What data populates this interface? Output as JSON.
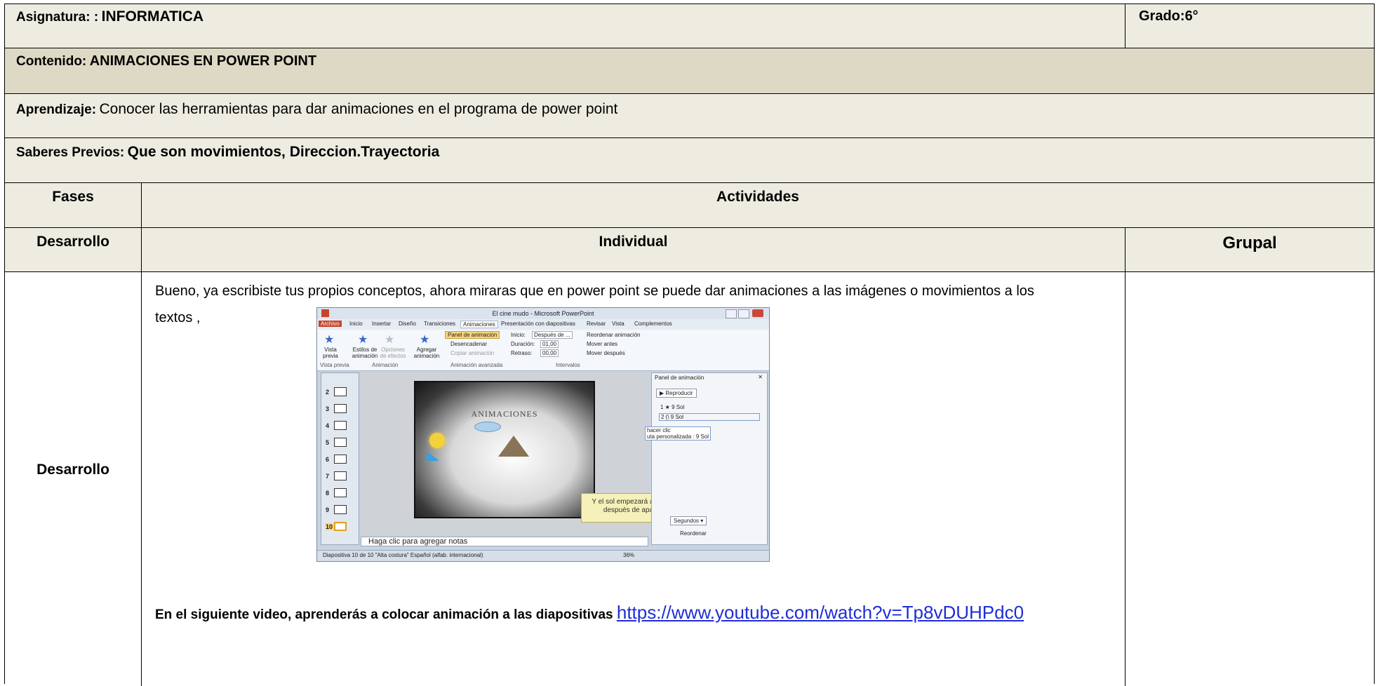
{
  "header": {
    "subject_label": "Asignatura: :",
    "subject_value": "INFORMATICA",
    "grade_label": "Grado:",
    "grade_value": "6°"
  },
  "content": {
    "label": "Contenido:",
    "value": "ANIMACIONES EN POWER POINT"
  },
  "learning": {
    "label": "Aprendizaje:",
    "value": "Conocer las herramientas para dar animaciones en el  programa de power point"
  },
  "prior": {
    "label": "Saberes Previos:",
    "value": "Que son movimientos, Direccion.Trayectoria"
  },
  "table": {
    "phases_header": "Fases",
    "activities_header": "Actividades",
    "dev_header": "Desarrollo",
    "individual_header": "Individual",
    "group_header": "Grupal",
    "row_phase": "Desarrollo",
    "intro_line1": "Bueno, ya escribiste tus propios conceptos, ahora miraras que en power point se puede dar animaciones a las imágenes o movimientos a los",
    "intro_line2": "textos  ,",
    "video_text": "En el siguiente video, aprenderás a colocar animación a las diapositivas",
    "video_link": "https://www.youtube.com/watch?v=Tp8vDUHPdc0"
  },
  "screenshot": {
    "window_title": "El cine mudo - Microsoft PowerPoint",
    "tabs": [
      "Archivo",
      "Inicio",
      "Insertar",
      "Diseño",
      "Transiciones",
      "Animaciones",
      "Presentación con diapositivas",
      "Revisar",
      "Vista",
      "Complementos"
    ],
    "ribbon_items": [
      "Vista previa",
      "Estilos de animación",
      "Opciones de efectos",
      "Agregar animación",
      "Panel de animación",
      "Desencadenar",
      "Copiar animación",
      "Inicio:",
      "Después de ...",
      "Duración:",
      "01,00",
      "Retraso:",
      "00,00",
      "Reordenar animación",
      "Mover antes",
      "Mover después"
    ],
    "ribbon_groups": [
      "Vista previa",
      "Animación",
      "Animación avanzada",
      "Intervalos"
    ],
    "slide_title": "ANIMACIONES",
    "tooltip": "Y el sol empezará a moverse después de aparecer.",
    "panel_title": "Panel de animación",
    "panel_play": "Reproducir",
    "panel_item1": "1 ★ 9 Sol",
    "panel_item2": "2 (\\ 9 Sol",
    "panel_hint1": "hacer clic",
    "panel_hint2": "uta personalizada : 9 Sol",
    "panel_seconds": "Segundos ▾",
    "panel_reorder": "Reordenar",
    "notes_placeholder": "Haga clic para agregar notas",
    "status_text": "Diapositiva 10 de 10   \"Alta costura\"   Español (alfab. internacional)",
    "zoom": "36%",
    "slide_numbers": [
      "2",
      "3",
      "4",
      "5",
      "6",
      "7",
      "8",
      "9",
      "10"
    ]
  }
}
